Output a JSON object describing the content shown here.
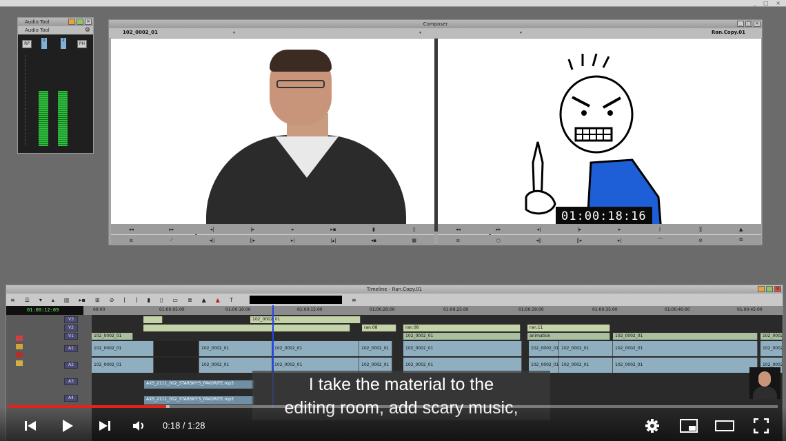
{
  "window": {
    "controls": "_ □ ×"
  },
  "audio_tool": {
    "title": "Audio Tool",
    "sub_title": "Audio Tool",
    "buttons": [
      "RP",
      "PH"
    ],
    "channels": [
      "1",
      "2"
    ]
  },
  "composer": {
    "title": "Composer",
    "source_clip": "102_0002_01",
    "record_clip": "Ran.Copy.01",
    "timecode_overlay": "01:00:18:16"
  },
  "timeline": {
    "title": "Timeline - Ran.Copy.01",
    "timecode": "01:00:12:09",
    "ruler_ticks": [
      "00:00",
      "01:00:05:00",
      "01:00:10:00",
      "01:00:15:00",
      "01:00:20:00",
      "01:00:25:00",
      "01:00:30:00",
      "01:00:35:00",
      "01:00:40:00",
      "01:00:45:00"
    ],
    "tracks": [
      "V3",
      "V2",
      "V1",
      "A1",
      "A2",
      "A3",
      "A4"
    ],
    "clip_names": {
      "v1": "102_0002_01",
      "ran08": "ran.08",
      "ran11": "ran.11",
      "animation": "animation",
      "music": "AXS_2111_002_STARSKY'S_FAVORITE.mp3",
      "music2": "AXS_2111_002_STARSKY'S_FAVORITE.mp3"
    }
  },
  "caption": {
    "line1": "I take the material to the",
    "line2": "editing room, add scary music,"
  },
  "player": {
    "time": "0:18 / 1:28",
    "progress_played": 0.205,
    "progress_loaded": 0.21
  },
  "colors": {
    "progress_red": "#e62117",
    "meter_green": "#2fc13e"
  },
  "icons": [
    "prev-icon",
    "play-icon",
    "next-icon",
    "volume-icon",
    "settings-icon",
    "miniplayer-icon",
    "theater-icon",
    "fullscreen-icon"
  ]
}
